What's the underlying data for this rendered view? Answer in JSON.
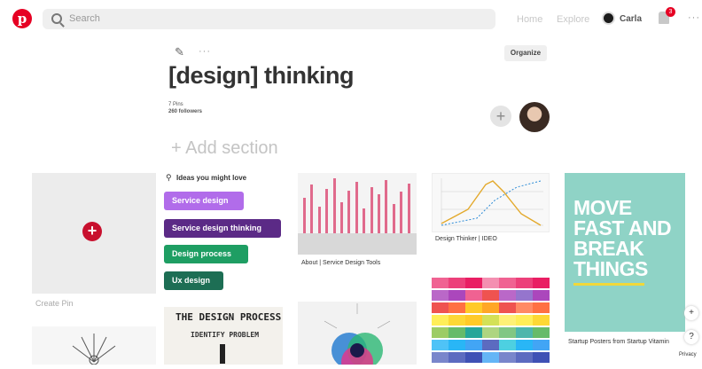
{
  "header": {
    "logo_glyph": "p",
    "search_placeholder": "Search",
    "nav_home": "Home",
    "nav_explore": "Explore",
    "user_name": "Carla",
    "notification_count": "3",
    "more_label": "···"
  },
  "board": {
    "edit_icon": "✎",
    "more_label": "···",
    "organize_label": "Organize",
    "title": "[design] thinking",
    "pins_count": "7 Pins",
    "followers_count": "260 followers",
    "add_collaborator": "+",
    "add_section_label": "+ Add section"
  },
  "create_pin": {
    "plus": "+",
    "label": "Create Pin"
  },
  "ideas": {
    "heading": "Ideas you might love",
    "chips": [
      {
        "label": "Service design",
        "color": "#b16cea"
      },
      {
        "label": "Service design thinking",
        "color": "#5b2a86"
      },
      {
        "label": "Design process",
        "color": "#1e9e63"
      },
      {
        "label": "Ux design",
        "color": "#1d6e54"
      }
    ]
  },
  "pins": {
    "about_caption": "About | Service Design Tools",
    "ideo_caption": "Design Thinker | IDEO",
    "move_text": [
      "MOVE",
      "FAST AND",
      "BREAK",
      "THINGS"
    ],
    "move_caption": "Startup Posters from Startup Vitamin",
    "process_title": "THE DESIGN PROCESS",
    "process_subtitle": "IDENTIFY PROBLEM"
  },
  "side": {
    "plus": "+",
    "help": "?",
    "privacy": "Privacy"
  },
  "colors": {
    "brand": "#e60023",
    "chip_purple": "#b16cea",
    "chip_deep_purple": "#5b2a86",
    "chip_green": "#1e9e63",
    "chip_dark_green": "#1d6e54",
    "poster_teal": "#8fd3c6"
  }
}
